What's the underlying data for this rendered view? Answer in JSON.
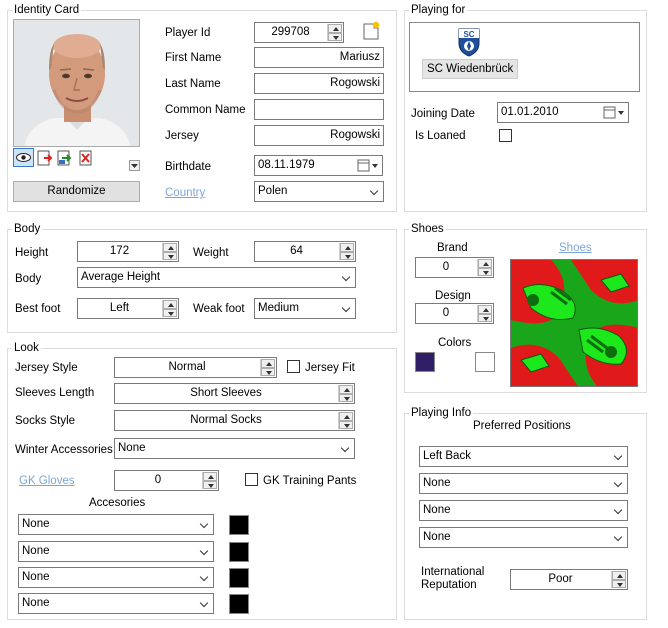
{
  "identity": {
    "title": "Identity Card",
    "player_id_label": "Player Id",
    "player_id": "299708",
    "first_name_label": "First Name",
    "first_name": "Mariusz",
    "last_name_label": "Last Name",
    "last_name": "Rogowski",
    "common_name_label": "Common Name",
    "common_name": "",
    "jersey_label": "Jersey",
    "jersey": "Rogowski",
    "birthdate_label": "Birthdate",
    "birthdate": "08.11.1979",
    "country_label": "Country",
    "country": "Polen",
    "randomize_label": "Randomize"
  },
  "playing_for": {
    "title": "Playing for",
    "club_name": "SC Wiedenbrück",
    "club_logo_text": "SC",
    "joining_date_label": "Joining Date",
    "joining_date": "01.01.2010",
    "is_loaned_label": "Is Loaned"
  },
  "body": {
    "title": "Body",
    "height_label": "Height",
    "height": "172",
    "weight_label": "Weight",
    "weight": "64",
    "body_label": "Body",
    "body_type": "Average Height",
    "best_foot_label": "Best foot",
    "best_foot": "Left",
    "weak_foot_label": "Weak foot",
    "weak_foot": "Medium"
  },
  "shoes": {
    "title": "Shoes",
    "brand_label": "Brand",
    "brand": "0",
    "design_label": "Design",
    "design": "0",
    "colors_label": "Colors",
    "link_label": "Shoes",
    "color1": "#2e1f66",
    "color2": "#ffffff"
  },
  "look": {
    "title": "Look",
    "jersey_style_label": "Jersey Style",
    "jersey_style": "Normal",
    "jersey_fit_label": "Jersey Fit",
    "sleeves_label": "Sleeves Length",
    "sleeves": "Short Sleeves",
    "socks_label": "Socks Style",
    "socks": "Normal Socks",
    "winter_label": "Winter Accessories",
    "winter": "None",
    "gk_gloves_label": "GK Gloves",
    "gk_gloves": "0",
    "gk_pants_label": "GK Training Pants",
    "accessories_label": "Accesories",
    "accessories": [
      "None",
      "None",
      "None",
      "None"
    ]
  },
  "playing_info": {
    "title": "Playing Info",
    "preferred_label": "Preferred Positions",
    "positions": [
      "Left Back",
      "None",
      "None",
      "None"
    ],
    "reputation_label": "International Reputation",
    "reputation": "Poor"
  }
}
